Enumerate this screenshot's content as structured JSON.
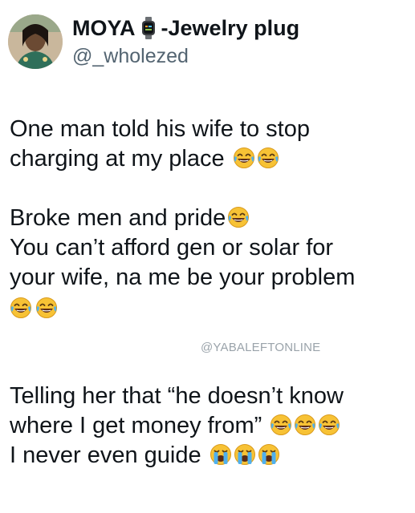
{
  "author": {
    "display_name": "MOYA",
    "display_suffix": "-Jewelry plug",
    "handle": "@_wholezed",
    "avatar_icon": "profile-photo",
    "name_icon": "watch-icon"
  },
  "tweet": {
    "line1": "One man told his wife to stop",
    "line2": "charging at my place",
    "line3": "Broke men and pride",
    "line4": "You can’t afford gen or solar for",
    "line5": "your wife, na me be your problem",
    "line6": "Telling her that “he doesn’t know",
    "line7": "where I get money from”",
    "line8": "I never even guide"
  },
  "emojis": {
    "laughing": "face-with-tears-of-joy",
    "crying": "loudly-crying-face"
  },
  "watermark": "@YABALEFTONLINE",
  "colors": {
    "text": "#0f1419",
    "handle": "#536471",
    "watermark": "#9aa3aa",
    "emoji_yellow": "#f7c235"
  }
}
